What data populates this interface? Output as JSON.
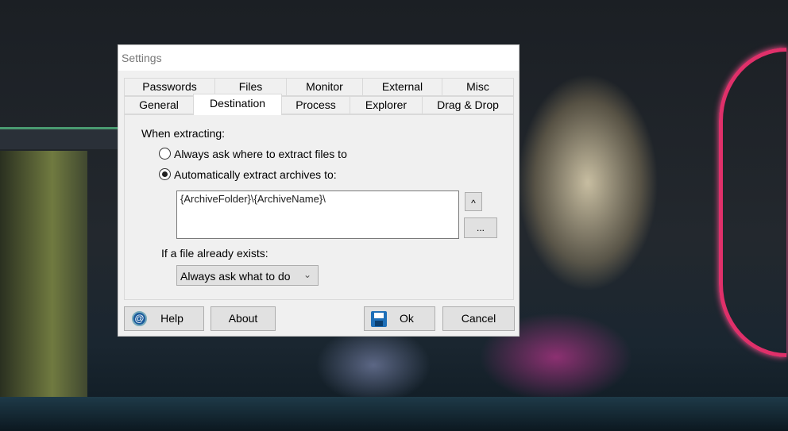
{
  "dialog": {
    "title": "Settings"
  },
  "tabs": {
    "row1": [
      "Passwords",
      "Files",
      "Monitor",
      "External",
      "Misc"
    ],
    "row2": [
      "General",
      "Destination",
      "Process",
      "Explorer",
      "Drag & Drop"
    ],
    "selected": "Destination"
  },
  "destination": {
    "when_label": "When extracting:",
    "radio_ask": "Always ask where to extract files to",
    "radio_auto": "Automatically extract archives to:",
    "selected_radio": "auto",
    "path_value": "{ArchiveFolder}\\{ArchiveName}\\",
    "up_button": "^",
    "browse_button": "...",
    "exists_label": "If a file already exists:",
    "exists_value": "Always ask what to do"
  },
  "buttons": {
    "help": "Help",
    "about": "About",
    "ok": "Ok",
    "cancel": "Cancel"
  }
}
